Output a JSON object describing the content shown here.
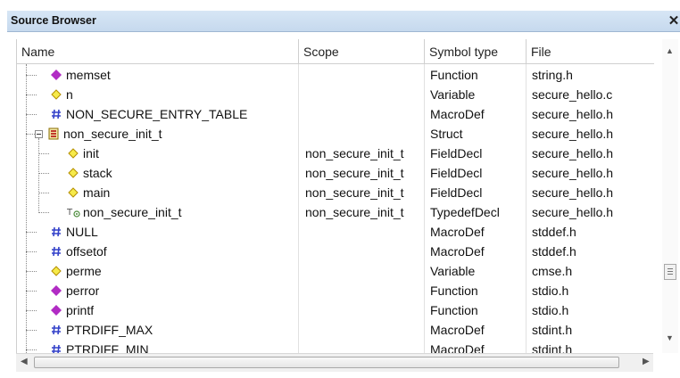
{
  "panel": {
    "title": "Source Browser",
    "close_glyph": "✕"
  },
  "columns": [
    {
      "label": "Name"
    },
    {
      "label": "Scope"
    },
    {
      "label": "Symbol type"
    },
    {
      "label": "File"
    }
  ],
  "rows": [
    {
      "name": "memset",
      "scope": "",
      "type": "Function",
      "file": "string.h",
      "icon": "function-icon"
    },
    {
      "name": "n",
      "scope": "",
      "type": "Variable",
      "file": "secure_hello.c",
      "icon": "variable-icon"
    },
    {
      "name": "NON_SECURE_ENTRY_TABLE",
      "scope": "",
      "type": "MacroDef",
      "file": "secure_hello.h",
      "icon": "macro-icon"
    },
    {
      "name": "non_secure_init_t",
      "scope": "",
      "type": "Struct",
      "file": "secure_hello.h",
      "icon": "struct-icon"
    },
    {
      "name": "init",
      "scope": "non_secure_init_t",
      "type": "FieldDecl",
      "file": "secure_hello.h",
      "icon": "variable-icon"
    },
    {
      "name": "stack",
      "scope": "non_secure_init_t",
      "type": "FieldDecl",
      "file": "secure_hello.h",
      "icon": "variable-icon"
    },
    {
      "name": "main",
      "scope": "non_secure_init_t",
      "type": "FieldDecl",
      "file": "secure_hello.h",
      "icon": "variable-icon"
    },
    {
      "name": "non_secure_init_t",
      "scope": "non_secure_init_t",
      "type": "TypedefDecl",
      "file": "secure_hello.h",
      "icon": "typedef-icon"
    },
    {
      "name": "NULL",
      "scope": "",
      "type": "MacroDef",
      "file": "stddef.h",
      "icon": "macro-icon"
    },
    {
      "name": "offsetof",
      "scope": "",
      "type": "MacroDef",
      "file": "stddef.h",
      "icon": "macro-icon"
    },
    {
      "name": "perme",
      "scope": "",
      "type": "Variable",
      "file": "cmse.h",
      "icon": "variable-icon"
    },
    {
      "name": "perror",
      "scope": "",
      "type": "Function",
      "file": "stdio.h",
      "icon": "function-icon"
    },
    {
      "name": "printf",
      "scope": "",
      "type": "Function",
      "file": "stdio.h",
      "icon": "function-icon"
    },
    {
      "name": "PTRDIFF_MAX",
      "scope": "",
      "type": "MacroDef",
      "file": "stdint.h",
      "icon": "macro-icon"
    },
    {
      "name": "PTRDIFF_MIN",
      "scope": "",
      "type": "MacroDef",
      "file": "stdint.h",
      "icon": "macro-icon"
    }
  ],
  "colors": {
    "function": "#b12cc4",
    "variable_fill": "#f6ea4a",
    "variable_stroke": "#b58f00",
    "macro": "#3341c9",
    "struct": "#c0392b",
    "titlebar": "#c9dcef"
  }
}
